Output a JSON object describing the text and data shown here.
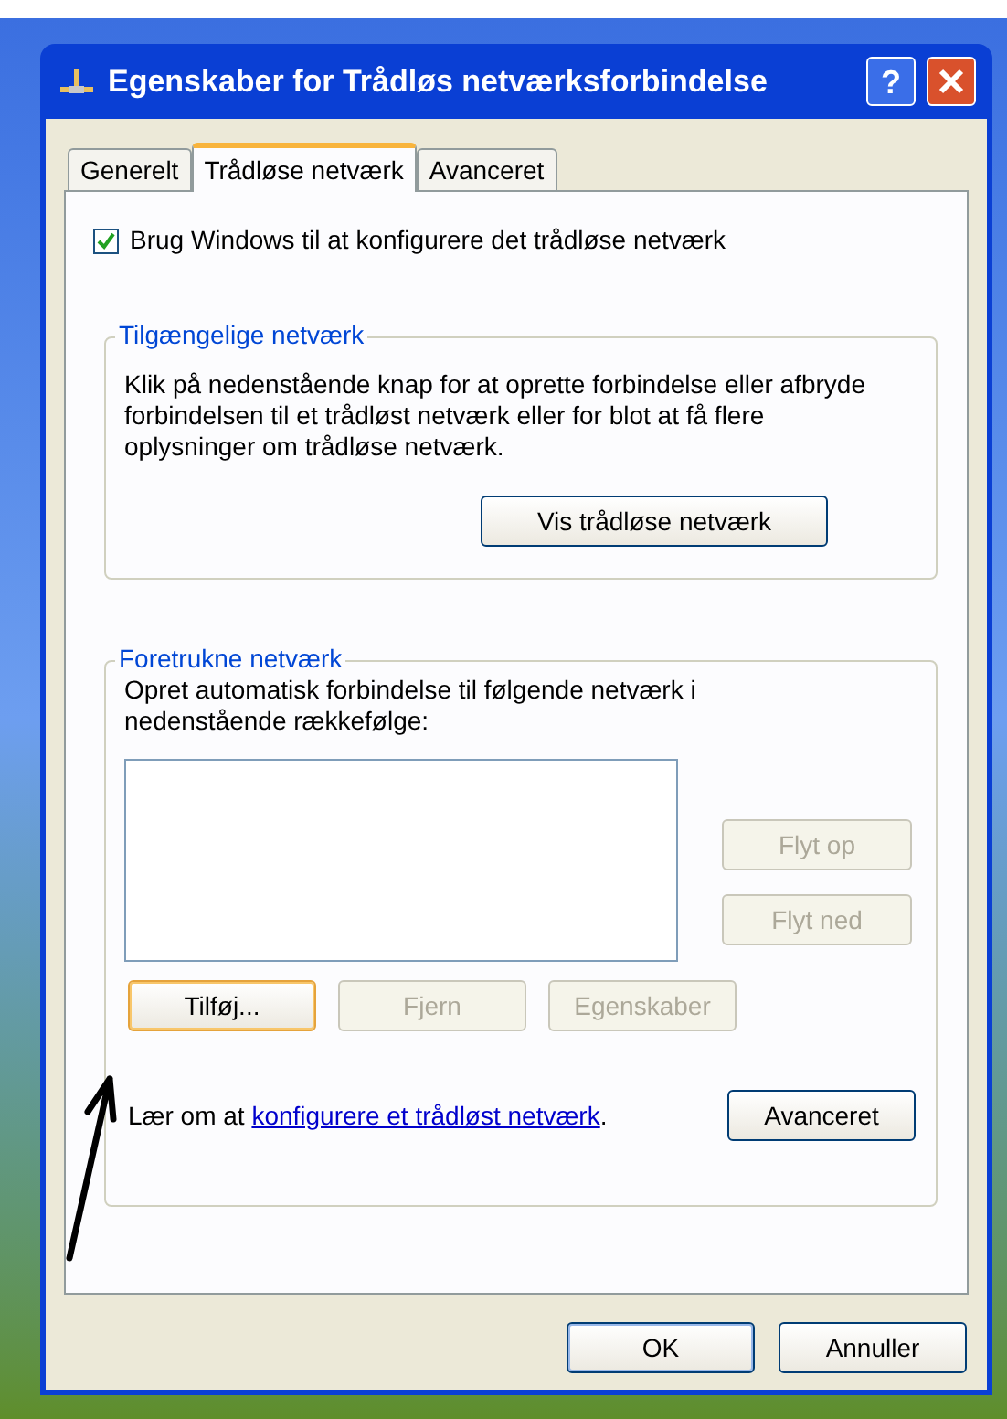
{
  "window": {
    "title": "Egenskaber for Trådløs netværksforbindelse",
    "help": "?"
  },
  "tabs": [
    {
      "label": "Generelt",
      "selected": false
    },
    {
      "label": "Trådløse netværk",
      "selected": true
    },
    {
      "label": "Avanceret",
      "selected": false
    }
  ],
  "use_windows": {
    "label": "Brug Windows til at konfigurere det trådløse netværk",
    "checked": true
  },
  "available": {
    "title": "Tilgængelige netværk",
    "text": "Klik på nedenstående knap for at oprette forbindelse eller afbryde forbindelsen til et trådløst netværk eller for blot at få flere oplysninger om trådløse netværk.",
    "button": "Vis trådløse netværk"
  },
  "preferred": {
    "title": "Foretrukne netværk",
    "text": "Opret automatisk forbindelse til følgende netværk i nedenstående rækkefølge:",
    "side_buttons": [
      {
        "label": "Flyt op",
        "disabled": true
      },
      {
        "label": "Flyt ned",
        "disabled": true
      }
    ],
    "row_buttons": [
      {
        "label": "Tilføj...",
        "disabled": false,
        "focused": true
      },
      {
        "label": "Fjern",
        "disabled": true,
        "focused": false
      },
      {
        "label": "Egenskaber",
        "disabled": true,
        "focused": false
      }
    ],
    "learn": {
      "text": "Lær om at",
      "link": "konfigurere et trådløst netværk",
      "suffix": "."
    },
    "advanced_button": "Avanceret"
  },
  "footer_buttons": [
    {
      "label": "OK",
      "default": true
    },
    {
      "label": "Annuller",
      "default": false
    }
  ]
}
